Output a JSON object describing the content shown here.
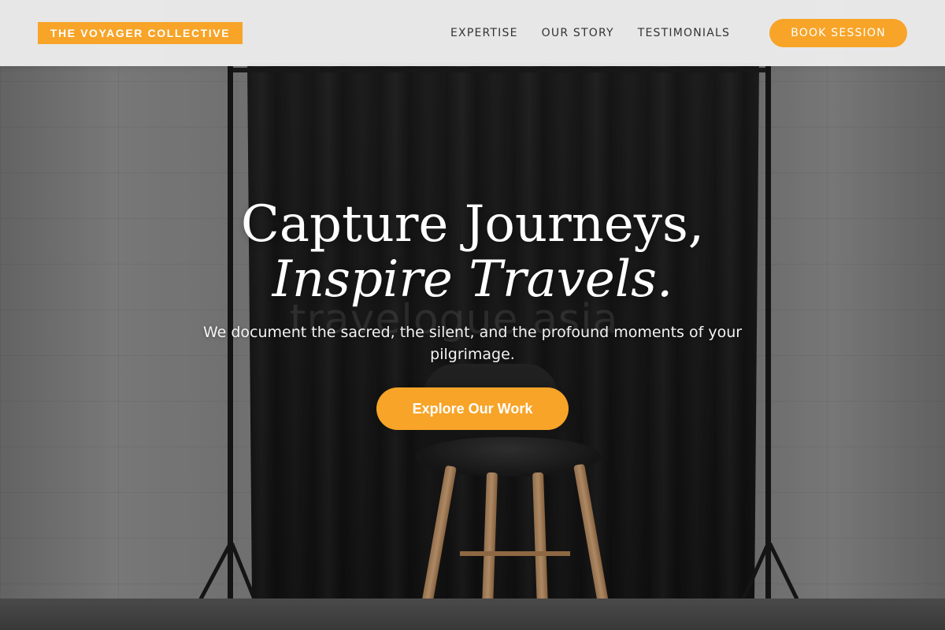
{
  "header": {
    "logo_text": "THE VOYAGER COLLECTIVE",
    "nav": {
      "items": [
        {
          "label": "EXPERTISE"
        },
        {
          "label": "OUR STORY"
        },
        {
          "label": "TESTIMONIALS"
        }
      ],
      "cta_label": "BOOK SESSION"
    }
  },
  "hero": {
    "title_line1": "Capture Journeys,",
    "title_line2": "Inspire Travels.",
    "subtitle": "We document the sacred, the silent, and the profound moments of your pilgrimage.",
    "button_label": "Explore Our Work",
    "watermark": "travelogue.asia"
  },
  "colors": {
    "accent": "#f7a428",
    "header_bg": "#ececec",
    "nav_text": "#333333",
    "hero_text": "#ffffff"
  },
  "icons": {
    "background_image": "photography-backdrop-with-stool"
  }
}
